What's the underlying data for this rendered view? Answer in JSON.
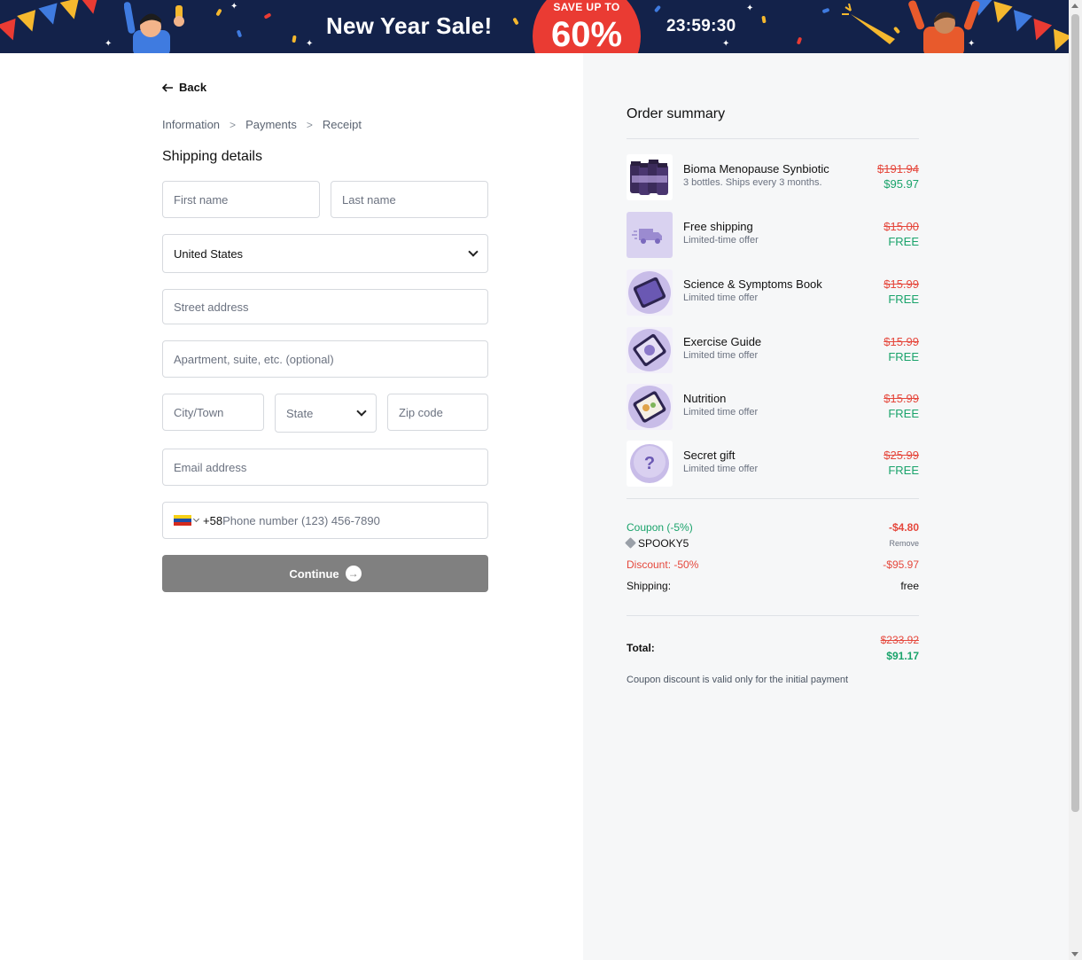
{
  "banner": {
    "title": "New Year Sale!",
    "save_label": "SAVE UP TO",
    "save_percent": "60%",
    "countdown": "23:59:30",
    "bg_color": "#13224a",
    "badge_color": "#ea3b33"
  },
  "nav": {
    "back_label": "Back",
    "breadcrumbs": [
      "Information",
      "Payments",
      "Receipt"
    ]
  },
  "form": {
    "section_title": "Shipping details",
    "first_name_placeholder": "First name",
    "last_name_placeholder": "Last name",
    "country_value": "United States",
    "street_placeholder": "Street address",
    "apartment_placeholder": "Apartment, suite, etc. (optional)",
    "city_placeholder": "City/Town",
    "state_value": "State",
    "zip_placeholder": "Zip code",
    "email_placeholder": "Email address",
    "phone_dial_code": "+58",
    "phone_placeholder": "Phone number (123) 456-7890",
    "phone_flag_icon": "venezuela-flag-icon",
    "continue_label": "Continue"
  },
  "summary": {
    "title": "Order summary",
    "items": [
      {
        "name": "Bioma Menopause Synbiotic",
        "sub": "3 bottles. Ships every 3 months.",
        "old_price": "$191.94",
        "new_price": "$95.97",
        "icon": "supplement-bottles-icon"
      },
      {
        "name": "Free shipping",
        "sub": "Limited-time offer",
        "old_price": "$15.00",
        "new_price": "FREE",
        "icon": "delivery-truck-icon"
      },
      {
        "name": "Science & Symptoms Book",
        "sub": "Limited time offer",
        "old_price": "$15.99",
        "new_price": "FREE",
        "icon": "book-tablet-icon"
      },
      {
        "name": "Exercise Guide",
        "sub": "Limited time offer",
        "old_price": "$15.99",
        "new_price": "FREE",
        "icon": "guide-tablet-icon"
      },
      {
        "name": "Nutrition",
        "sub": "Limited time offer",
        "old_price": "$15.99",
        "new_price": "FREE",
        "icon": "nutrition-tablet-icon"
      },
      {
        "name": "Secret gift",
        "sub": "Limited time offer",
        "old_price": "$25.99",
        "new_price": "FREE",
        "icon": "question-mark-icon"
      }
    ],
    "coupon_label": "Coupon (-5%)",
    "coupon_amount": "-$4.80",
    "coupon_code": "SPOOKY5",
    "remove_label": "Remove",
    "discount_label": "Discount: -50%",
    "discount_amount": "-$95.97",
    "shipping_label": "Shipping:",
    "shipping_value": "free",
    "total_label": "Total:",
    "total_old": "$233.92",
    "total_new": "$91.17",
    "note": "Coupon discount is valid only for the initial payment"
  },
  "colors": {
    "accent_green": "#1aa36b",
    "accent_red": "#e5483d",
    "panel_bg": "#f6f7f8",
    "button_gray": "#808080"
  }
}
